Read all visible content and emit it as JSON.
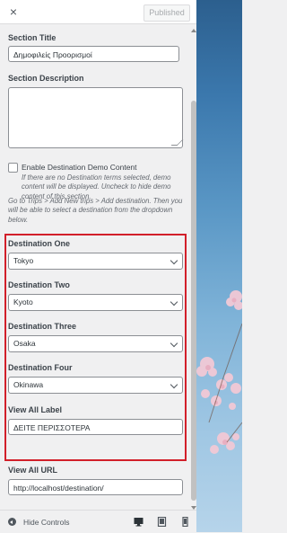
{
  "topbar": {
    "close_label": "×",
    "publish_label": "Published"
  },
  "section_title": {
    "label": "Section Title",
    "value": "Δημοφιλείς Προορισμοί"
  },
  "section_description": {
    "label": "Section Description",
    "value": ""
  },
  "demo_content": {
    "label": "Enable Destination Demo Content",
    "checked": false,
    "help": "If there are no Destination terms selected, demo content will be displayed. Uncheck to hide demo content of this section."
  },
  "instructions": "Go to Trips > Add New trips > Add destination. Then you will be able to select a destination from the dropdown below.",
  "destinations": [
    {
      "label": "Destination One",
      "value": "Tokyo"
    },
    {
      "label": "Destination Two",
      "value": "Kyoto"
    },
    {
      "label": "Destination Three",
      "value": "Osaka"
    },
    {
      "label": "Destination Four",
      "value": "Okinawa"
    }
  ],
  "view_all_label": {
    "label": "View All Label",
    "value": "ΔΕΙΤΕ ΠΕΡΙΣΣΟΤΕΡΑ"
  },
  "view_all_url": {
    "label": "View All URL",
    "value": "http://localhost/destination/"
  },
  "footer": {
    "hide_controls_label": "Hide Controls",
    "devices": [
      "desktop-icon",
      "tablet-icon",
      "mobile-icon"
    ]
  },
  "colors": {
    "highlight": "#d21f2a",
    "preview_sky": "#3b78ad",
    "blossom": "#f2c9d6"
  }
}
